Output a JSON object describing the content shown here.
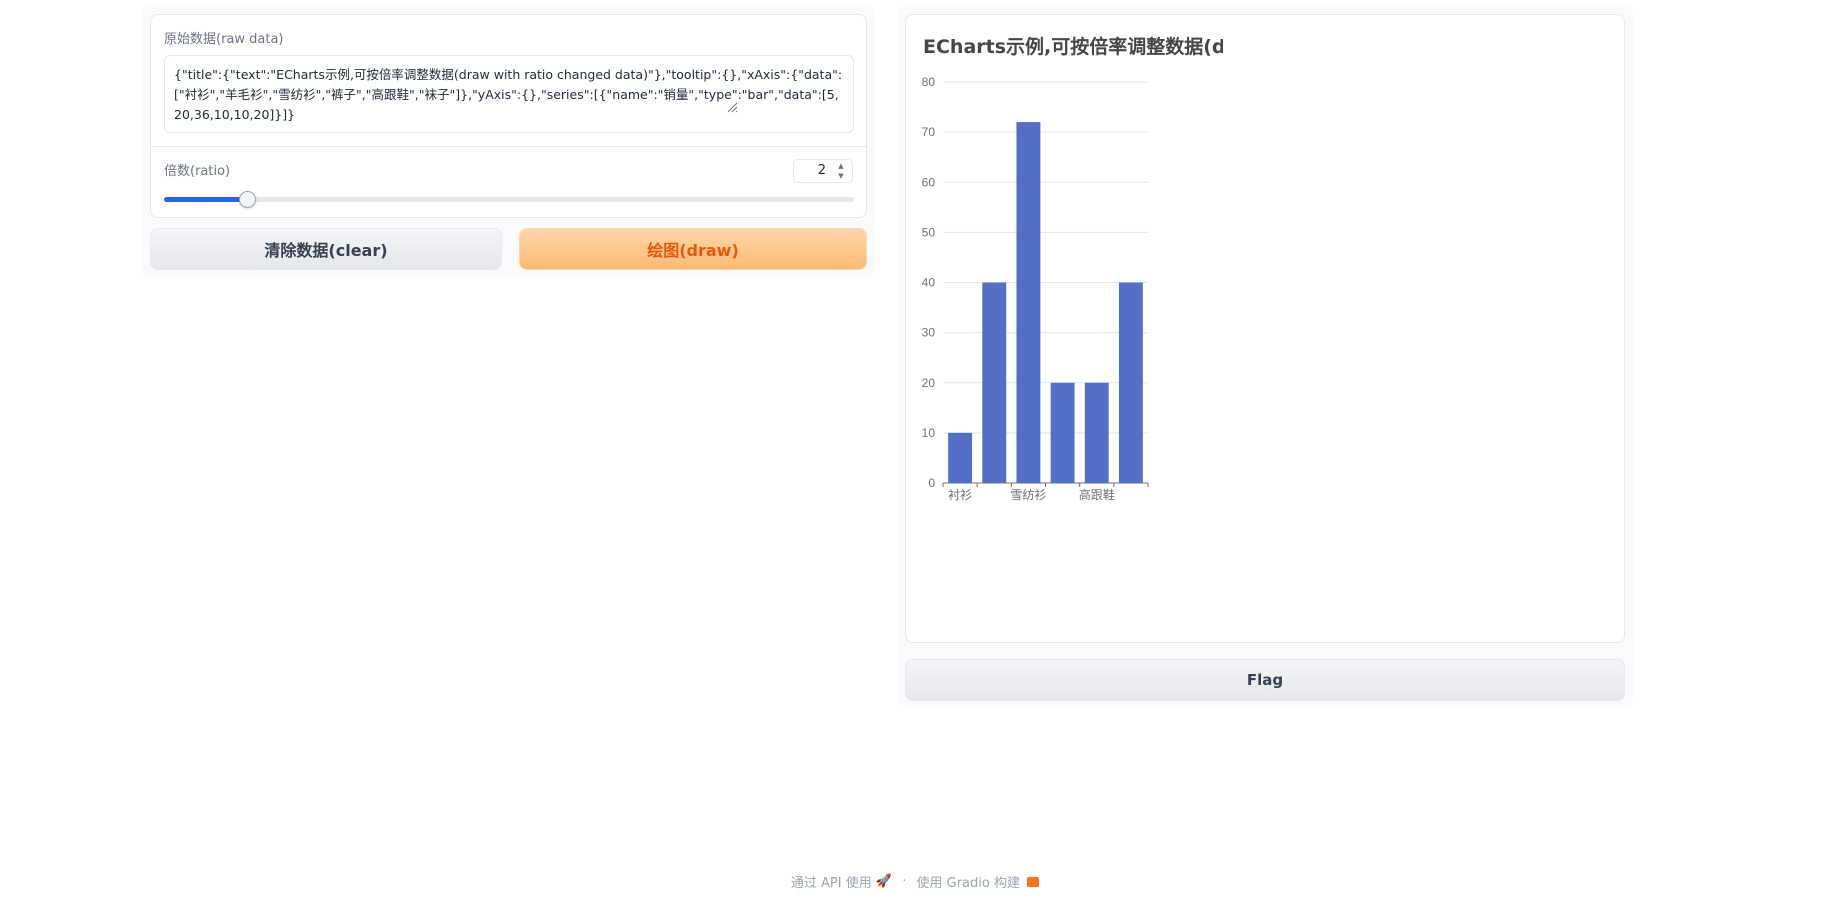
{
  "input_panel": {
    "raw_data_label": "原始数据(raw data)",
    "raw_data_value": "{\"title\":{\"text\":\"ECharts示例,可按倍率调整数据(draw with ratio changed data)\"},\"tooltip\":{},\"xAxis\":{\"data\":[\"衬衫\",\"羊毛衫\",\"雪纺衫\",\"裤子\",\"高跟鞋\",\"袜子\"]},\"yAxis\":{},\"series\":[{\"name\":\"销量\",\"type\":\"bar\",\"data\":[5,20,36,10,10,20]}]}",
    "ratio_label": "倍数(ratio)",
    "ratio_value": "2",
    "slider_fraction": 0.12,
    "clear_button": "清除数据(clear)",
    "draw_button": "绘图(draw)"
  },
  "output_panel": {
    "flag_button": "Flag"
  },
  "chart_data": {
    "type": "bar",
    "title": "ECharts示例,可按倍率调整数据(draw with ratio changed data)",
    "categories": [
      "衬衫",
      "羊毛衫",
      "雪纺衫",
      "裤子",
      "高跟鞋",
      "袜子"
    ],
    "visible_tick_labels": [
      "衬衫",
      "雪纺衫",
      "高跟鞋"
    ],
    "series": [
      {
        "name": "销量",
        "values": [
          10,
          40,
          72,
          20,
          20,
          40
        ]
      }
    ],
    "ylim": [
      0,
      80
    ],
    "yticks": [
      0,
      10,
      20,
      30,
      40,
      50,
      60,
      70,
      80
    ],
    "grid": true,
    "bar_color": "#5470c6"
  },
  "footer": {
    "api_text": "通过 API 使用",
    "separator": "·",
    "gradio_text": "使用 Gradio 构建"
  },
  "colors": {
    "accent_blue": "#2563eb",
    "draw_orange": "#ea580c"
  }
}
